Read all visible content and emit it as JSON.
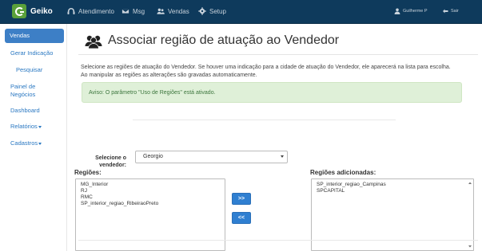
{
  "navbar": {
    "brand": "Geiko",
    "items": [
      {
        "label": "Atendimento",
        "icon": "headset-icon"
      },
      {
        "label": "Msg",
        "icon": "envelope-icon"
      },
      {
        "label": "Vendas",
        "icon": "users-icon"
      },
      {
        "label": "Setup",
        "icon": "gear-icon"
      }
    ],
    "user": "Guilherme P",
    "logout": "Sair"
  },
  "sidebar": {
    "items": [
      {
        "label": "Vendas"
      },
      {
        "label": "Gerar Indicação"
      },
      {
        "label": "Pesquisar"
      },
      {
        "label": "Painel de"
      },
      {
        "label": "Negócios"
      },
      {
        "label": "Dashboard"
      },
      {
        "label": "Relatórios"
      },
      {
        "label": "Cadastros"
      }
    ]
  },
  "page": {
    "title": "Associar região de atuação ao Vendedor",
    "intro_line1": "Selecione as regiões de atuação do Vendedor. Se houver uma indicação para a cidade de atuação do Vendedor, ele aparecerá na lista para escolha.",
    "intro_line2": "Ao manipular as regiões as alterações são gravadas automaticamente.",
    "alert": "Aviso: O parâmetro \"Uso de Regiões\" está ativado."
  },
  "form": {
    "seller_label_1": "Selecione o",
    "seller_label_2": "vendedor:",
    "seller_value": "Georgio",
    "regions_label": "Regiões:",
    "regions": [
      "MG_Interior",
      "RJ",
      "RMC",
      "SP_interior_regiao_RibeiraoPreto"
    ],
    "added_label": "Regiões adicionadas:",
    "added_regions": [
      "SP_interior_regiao_Campinas",
      "SPCAPITAL"
    ],
    "add_button": ">>",
    "remove_button": "<<"
  }
}
